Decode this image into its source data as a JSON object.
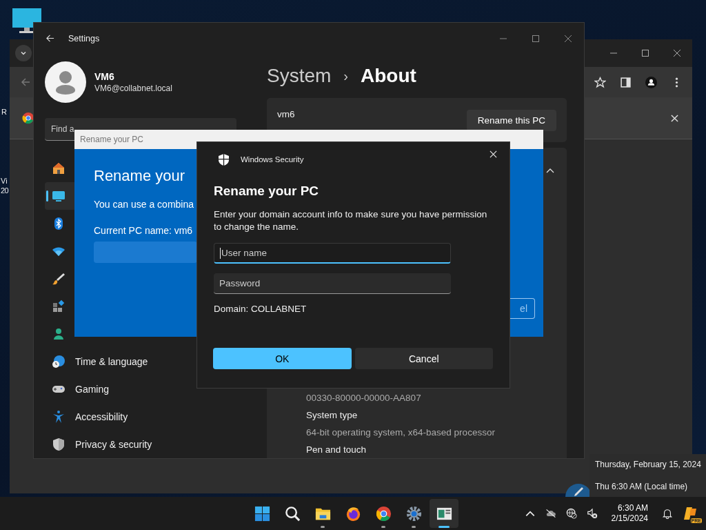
{
  "desktop": {
    "labels": [
      "R",
      "Vi",
      "20"
    ]
  },
  "settings": {
    "title": "Settings",
    "user": {
      "name": "VM6",
      "email": "VM6@collabnet.local"
    },
    "search": {
      "placeholder": "Find a"
    },
    "nav": [
      {
        "selected": false
      },
      {
        "selected": true
      },
      {
        "selected": false
      },
      {
        "selected": false
      },
      {
        "selected": false
      },
      {
        "selected": false
      },
      {
        "selected": false
      },
      {
        "label": "Time & language",
        "selected": false
      },
      {
        "label": "Gaming",
        "selected": false
      },
      {
        "label": "Accessibility",
        "selected": false
      },
      {
        "label": "Privacy & security",
        "selected": false
      }
    ],
    "breadcrumb": {
      "parent": "System",
      "separator": "›",
      "current": "About"
    },
    "device": {
      "name": "vm6",
      "rename_button": "Rename this PC"
    },
    "specs": [
      {
        "kind": "value",
        "text": "00330-80000-00000-AA807"
      },
      {
        "kind": "label",
        "text": "System type"
      },
      {
        "kind": "value",
        "text": "64-bit operating system, x64-based processor"
      },
      {
        "kind": "label",
        "text": "Pen and touch"
      }
    ]
  },
  "rename_dialog": {
    "title": "Rename your PC",
    "heading": "Rename your",
    "description": "You can use a combina",
    "current_name": "Current PC name: vm6",
    "partial_button": "el"
  },
  "security_dialog": {
    "app": "Windows Security",
    "heading": "Rename your PC",
    "description": "Enter your domain account info to make sure you have permission to change the name.",
    "fields": [
      {
        "placeholder": "User name",
        "focused": true
      },
      {
        "placeholder": "Password",
        "focused": false
      }
    ],
    "domain": "Domain: COLLABNET",
    "buttons": [
      {
        "label": "OK",
        "kind": "primary"
      },
      {
        "label": "Cancel",
        "kind": "secondary"
      }
    ]
  },
  "clock_flyout": {
    "date": "Thursday, February 15, 2024",
    "time": "Thu 6:30 AM (Local time)"
  },
  "taskbar": {
    "apps": [
      {
        "running": false,
        "selected": false
      },
      {
        "running": false,
        "selected": false
      },
      {
        "running": true,
        "selected": false
      },
      {
        "running": false,
        "selected": false
      },
      {
        "running": true,
        "selected": false
      },
      {
        "running": true,
        "selected": false
      },
      {
        "running": true,
        "selected": true
      }
    ],
    "time": "6:30 AM",
    "date": "2/15/2024",
    "badge": "PRE"
  }
}
